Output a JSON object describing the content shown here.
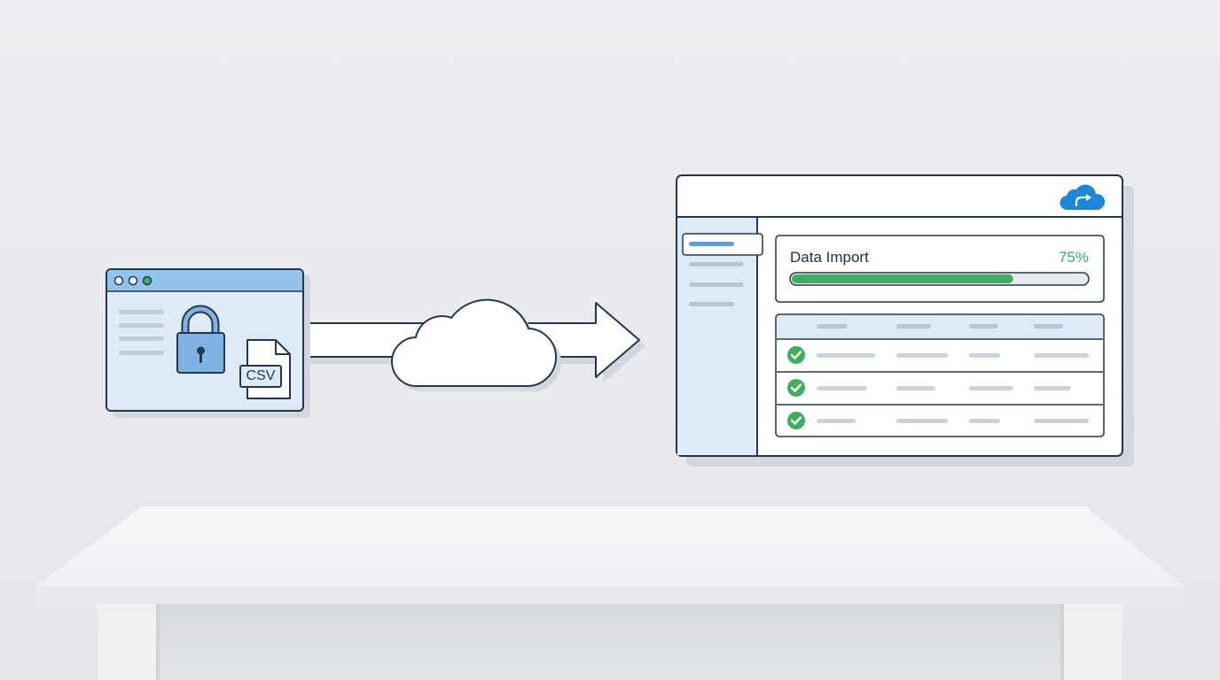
{
  "source_window": {
    "file_badge": "CSV",
    "icons": [
      "lock-icon",
      "csv-file-icon"
    ]
  },
  "transfer": {
    "icons": [
      "cloud-icon",
      "arrow-right-icon"
    ]
  },
  "app_window": {
    "header_icon": "cloud-upload-icon",
    "import_card": {
      "title": "Data Import",
      "percent": "75%",
      "progress": 0.75
    },
    "results_rows": [
      {
        "status": "success"
      },
      {
        "status": "success"
      },
      {
        "status": "success"
      }
    ]
  },
  "colors": {
    "accent_blue": "#1e88d6",
    "success_green": "#3fae62",
    "window_blue": "#dfeaf7",
    "titlebar_blue": "#93c2ec",
    "outline": "#25374b"
  }
}
